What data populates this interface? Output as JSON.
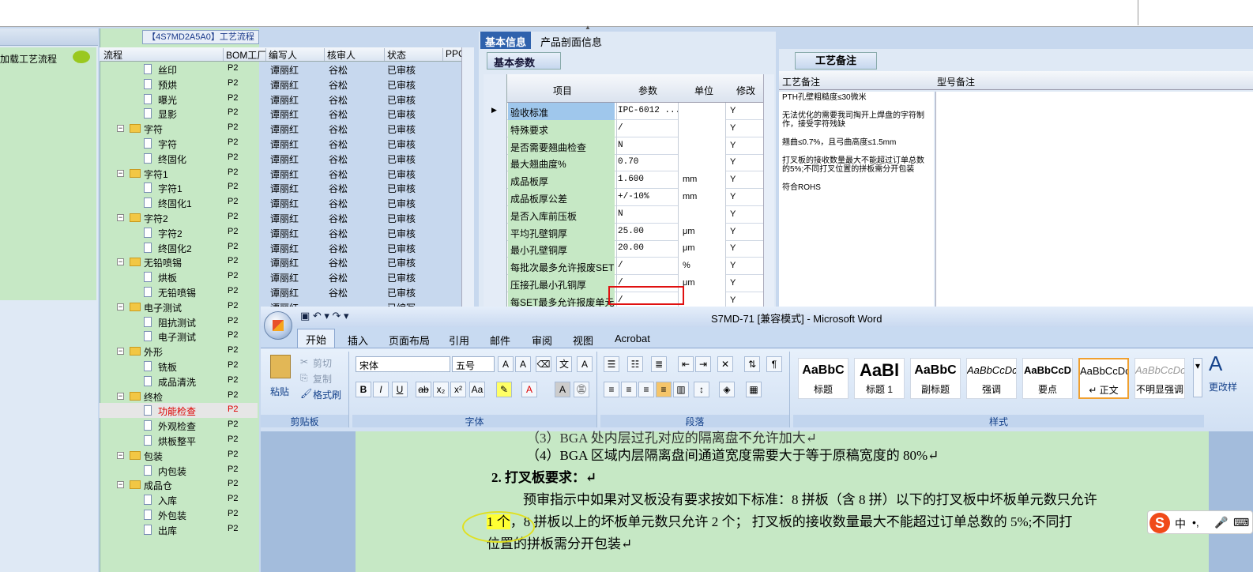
{
  "left_panel": {
    "load_label": "加载工艺流程"
  },
  "tree": {
    "title": "【4S7MD2A5A0】工艺流程",
    "headers": [
      "流程",
      "BOM工厂",
      "编写人",
      "核审人",
      "状态",
      "PPC"
    ],
    "rows": [
      {
        "name": "丝印",
        "type": "doc",
        "level": 2,
        "bom": "P2",
        "writer": "谭丽红",
        "reviewer": "谷松",
        "status": "已审核"
      },
      {
        "name": "预烘",
        "type": "doc",
        "level": 2,
        "bom": "P2",
        "writer": "谭丽红",
        "reviewer": "谷松",
        "status": "已审核"
      },
      {
        "name": "曝光",
        "type": "doc",
        "level": 2,
        "bom": "P2",
        "writer": "谭丽红",
        "reviewer": "谷松",
        "status": "已审核"
      },
      {
        "name": "显影",
        "type": "doc",
        "level": 2,
        "bom": "P2",
        "writer": "谭丽红",
        "reviewer": "谷松",
        "status": "已审核"
      },
      {
        "name": "字符",
        "type": "folder",
        "level": 1,
        "bom": "P2",
        "writer": "谭丽红",
        "reviewer": "谷松",
        "status": "已审核"
      },
      {
        "name": "字符",
        "type": "doc",
        "level": 2,
        "bom": "P2",
        "writer": "谭丽红",
        "reviewer": "谷松",
        "status": "已审核"
      },
      {
        "name": "终固化",
        "type": "doc",
        "level": 2,
        "bom": "P2",
        "writer": "谭丽红",
        "reviewer": "谷松",
        "status": "已审核"
      },
      {
        "name": "字符1",
        "type": "folder",
        "level": 1,
        "bom": "P2",
        "writer": "谭丽红",
        "reviewer": "谷松",
        "status": "已审核"
      },
      {
        "name": "字符1",
        "type": "doc",
        "level": 2,
        "bom": "P2",
        "writer": "谭丽红",
        "reviewer": "谷松",
        "status": "已审核"
      },
      {
        "name": "终固化1",
        "type": "doc",
        "level": 2,
        "bom": "P2",
        "writer": "谭丽红",
        "reviewer": "谷松",
        "status": "已审核"
      },
      {
        "name": "字符2",
        "type": "folder",
        "level": 1,
        "bom": "P2",
        "writer": "谭丽红",
        "reviewer": "谷松",
        "status": "已审核"
      },
      {
        "name": "字符2",
        "type": "doc",
        "level": 2,
        "bom": "P2",
        "writer": "谭丽红",
        "reviewer": "谷松",
        "status": "已审核"
      },
      {
        "name": "终固化2",
        "type": "doc",
        "level": 2,
        "bom": "P2",
        "writer": "谭丽红",
        "reviewer": "谷松",
        "status": "已审核"
      },
      {
        "name": "无铅喷锡",
        "type": "folder",
        "level": 1,
        "bom": "P2",
        "writer": "谭丽红",
        "reviewer": "谷松",
        "status": "已审核"
      },
      {
        "name": "烘板",
        "type": "doc",
        "level": 2,
        "bom": "P2",
        "writer": "谭丽红",
        "reviewer": "谷松",
        "status": "已审核"
      },
      {
        "name": "无铅喷锡",
        "type": "doc",
        "level": 2,
        "bom": "P2",
        "writer": "谭丽红",
        "reviewer": "谷松",
        "status": "已审核"
      },
      {
        "name": "电子测试",
        "type": "folder",
        "level": 1,
        "bom": "P2",
        "writer": "谭丽红",
        "reviewer": "",
        "status": "已编写"
      },
      {
        "name": "阻抗测试",
        "type": "doc",
        "level": 2,
        "bom": "P2",
        "writer": "",
        "reviewer": "",
        "status": ""
      },
      {
        "name": "电子测试",
        "type": "doc",
        "level": 2,
        "bom": "P2",
        "writer": "",
        "reviewer": "",
        "status": ""
      },
      {
        "name": "外形",
        "type": "folder",
        "level": 1,
        "bom": "P2",
        "writer": "",
        "reviewer": "",
        "status": ""
      },
      {
        "name": "铣板",
        "type": "doc",
        "level": 2,
        "bom": "P2",
        "writer": "",
        "reviewer": "",
        "status": ""
      },
      {
        "name": "成品清洗",
        "type": "doc",
        "level": 2,
        "bom": "P2",
        "writer": "",
        "reviewer": "",
        "status": ""
      },
      {
        "name": "终检",
        "type": "folder",
        "level": 1,
        "bom": "P2",
        "writer": "",
        "reviewer": "",
        "status": ""
      },
      {
        "name": "功能检查",
        "type": "doc",
        "level": 2,
        "bom": "P2",
        "writer": "",
        "reviewer": "",
        "status": "",
        "selected": true
      },
      {
        "name": "外观检查",
        "type": "doc",
        "level": 2,
        "bom": "P2",
        "writer": "",
        "reviewer": "",
        "status": ""
      },
      {
        "name": "烘板整平",
        "type": "doc",
        "level": 2,
        "bom": "P2",
        "writer": "",
        "reviewer": "",
        "status": ""
      },
      {
        "name": "包装",
        "type": "folder",
        "level": 1,
        "bom": "P2",
        "writer": "",
        "reviewer": "",
        "status": ""
      },
      {
        "name": "内包装",
        "type": "doc",
        "level": 2,
        "bom": "P2",
        "writer": "",
        "reviewer": "",
        "status": ""
      },
      {
        "name": "成品仓",
        "type": "folder",
        "level": 1,
        "bom": "P2",
        "writer": "",
        "reviewer": "",
        "status": ""
      },
      {
        "name": "入库",
        "type": "doc",
        "level": 2,
        "bom": "P2",
        "writer": "",
        "reviewer": "",
        "status": ""
      },
      {
        "name": "外包装",
        "type": "doc",
        "level": 2,
        "bom": "P2",
        "writer": "",
        "reviewer": "",
        "status": ""
      },
      {
        "name": "出库",
        "type": "doc",
        "level": 2,
        "bom": "P2",
        "writer": "",
        "reviewer": "",
        "status": ""
      }
    ]
  },
  "info": {
    "tabs": [
      "基本信息",
      "产品剖面信息"
    ],
    "subtab": "基本参数",
    "headers": [
      "项目",
      "参数",
      "单位",
      "修改"
    ],
    "rows": [
      {
        "item": "验收标准",
        "param": "IPC-6012 ...",
        "unit": "",
        "mod": "Y"
      },
      {
        "item": "特殊要求",
        "param": "/",
        "unit": "",
        "mod": "Y"
      },
      {
        "item": "是否需要翘曲检查",
        "param": "N",
        "unit": "",
        "mod": "Y"
      },
      {
        "item": "最大翘曲度%",
        "param": "0.70",
        "unit": "",
        "mod": "Y"
      },
      {
        "item": "成品板厚",
        "param": "1.600",
        "unit": "mm",
        "mod": "Y"
      },
      {
        "item": "成品板厚公差",
        "param": "+/-10%",
        "unit": "mm",
        "mod": "Y"
      },
      {
        "item": "是否入库前压板",
        "param": "N",
        "unit": "",
        "mod": "Y"
      },
      {
        "item": "平均孔壁铜厚",
        "param": "25.00",
        "unit": "μm",
        "mod": "Y"
      },
      {
        "item": "最小孔壁铜厚",
        "param": "20.00",
        "unit": "μm",
        "mod": "Y"
      },
      {
        "item": "每批次最多允许报废SET",
        "param": "/",
        "unit": "%",
        "mod": "Y"
      },
      {
        "item": "压接孔最小孔铜厚",
        "param": "/",
        "unit": "μm",
        "mod": "Y"
      },
      {
        "item": "每SET最多允许报废单元",
        "param": "/",
        "unit": "",
        "mod": "Y"
      }
    ]
  },
  "notes": {
    "tab": "工艺备注",
    "col1": "工艺备注",
    "col2": "型号备注",
    "lines": [
      "PTH孔壁粗糙度≤30微米",
      "无法优化的需要我司掏开上焊盘的字符制作，接受字符残缺",
      "翘曲≤0.7%，且弓曲高度≤1.5mm",
      "打叉板的接收数量最大不能超过订单总数的5%;不同打叉位置的拼板需分开包装",
      "符合ROHS"
    ]
  },
  "word": {
    "title": "S7MD-71 [兼容模式] - Microsoft Word",
    "tabs": [
      "开始",
      "插入",
      "页面布局",
      "引用",
      "邮件",
      "审阅",
      "视图",
      "Acrobat"
    ],
    "clipboard": {
      "paste": "粘贴",
      "cut": "剪切",
      "copy": "复制",
      "format": "格式刷",
      "label": "剪贴板"
    },
    "font": {
      "name": "宋体",
      "size": "五号",
      "label": "字体"
    },
    "paragraph_label": "段落",
    "styles": [
      {
        "sample": "AaBbC",
        "name": "标题"
      },
      {
        "sample": "AaBl",
        "name": "标题 1"
      },
      {
        "sample": "AaBbC",
        "name": "副标题"
      },
      {
        "sample": "AaBbCcDc",
        "name": "强调"
      },
      {
        "sample": "AaBbCcD",
        "name": "要点"
      },
      {
        "sample": "AaBbCcDc",
        "name": "↵ 正文"
      },
      {
        "sample": "AaBbCcDc",
        "name": "不明显强调"
      }
    ],
    "styles_label": "样式",
    "change_styles": "更改样",
    "doc": {
      "line0": "（3）BGA 处内层过孔对应的隔离盘不允许加大↵",
      "line1": "（4）BGA 区域内层隔离盘间通道宽度需要大于等于原稿宽度的 80%↵",
      "heading": "2. 打叉板要求：↵",
      "para1": "预审指示中如果对叉板没有要求按如下标准：8 拼板（含 8 拼）以下的打叉板中坏板单元数只允许",
      "highlight": "1 个",
      "para2": "，8 拼板以上的坏板单元数只允许 2 个；  打叉板的接收数量最大不能超过订单总数的 5%;不同打",
      "para3": "位置的拼板需分开包装↵"
    }
  },
  "ime": {
    "lang": "中",
    "punct": "•,"
  }
}
